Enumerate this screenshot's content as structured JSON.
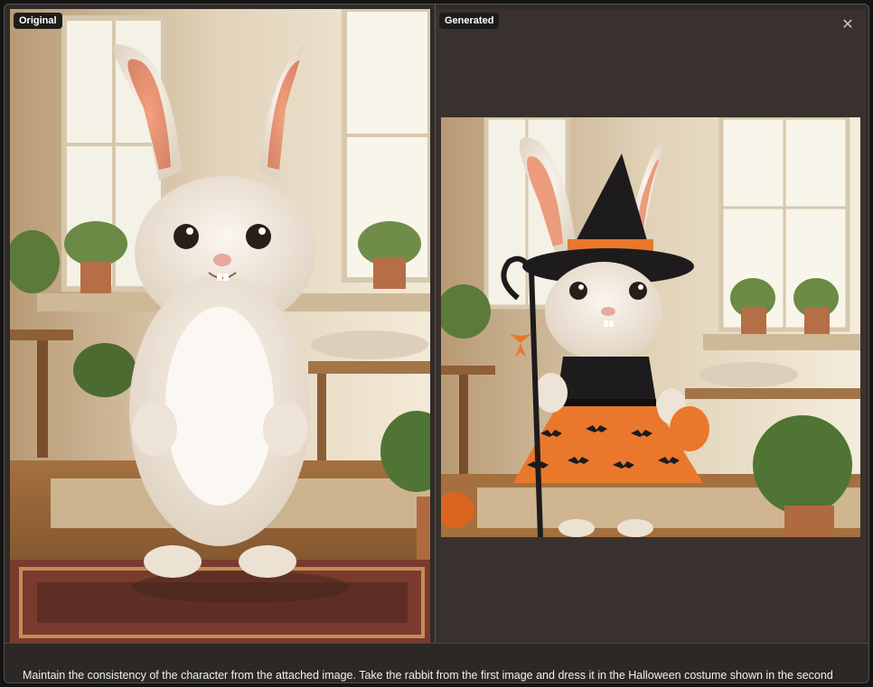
{
  "panels": {
    "original_label": "Original",
    "generated_label": "Generated"
  },
  "icons": {
    "close": "close-icon"
  },
  "caption": {
    "text": "Maintain the consistency of the character from the attached image. Take the rabbit from the first image and dress it in the Halloween costume shown in the second image."
  },
  "colors": {
    "background": "#2f2b29",
    "badge": "#1f1d1c",
    "costume_orange": "#e9782c",
    "costume_black": "#1d1b1c"
  }
}
